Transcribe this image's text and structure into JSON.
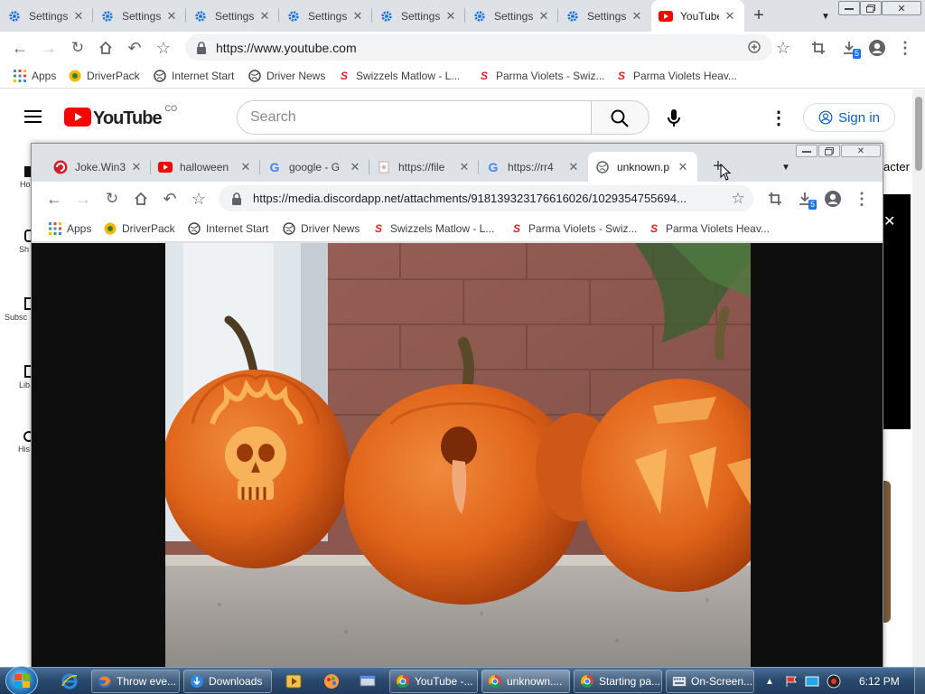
{
  "outer_window": {
    "tabs": [
      {
        "label": "Settings",
        "icon": "gear-icon"
      },
      {
        "label": "Settings",
        "icon": "gear-icon"
      },
      {
        "label": "Settings",
        "icon": "gear-icon"
      },
      {
        "label": "Settings",
        "icon": "gear-icon"
      },
      {
        "label": "Settings",
        "icon": "gear-icon"
      },
      {
        "label": "Settings",
        "icon": "gear-icon"
      },
      {
        "label": "Settings",
        "icon": "gear-icon"
      },
      {
        "label": "YouTube",
        "icon": "youtube-icon",
        "active": true
      }
    ],
    "url": "https://www.youtube.com",
    "download_badge": "5",
    "bookmarks": [
      "Apps",
      "DriverPack",
      "Internet Start",
      "Driver News",
      "Swizzels Matlow - L...",
      "Parma Violets - Swiz...",
      "Parma Violets Heav..."
    ]
  },
  "youtube": {
    "logo_text": "YouTube",
    "country_code": "CO",
    "search_placeholder": "Search",
    "sign_in": "Sign in",
    "sidebar": [
      "Ho",
      "Sh",
      "Subsc",
      "Lib",
      "His"
    ],
    "right_peek_text": "acter"
  },
  "inner_window": {
    "tabs": [
      {
        "label": "Joke.Win32",
        "icon": "antivirus-icon"
      },
      {
        "label": "halloween",
        "icon": "youtube-icon"
      },
      {
        "label": "google - G",
        "icon": "google-icon"
      },
      {
        "label": "https://file",
        "icon": "file-icon"
      },
      {
        "label": "https://rr4",
        "icon": "google-icon"
      },
      {
        "label": "unknown.p",
        "icon": "globe-icon",
        "active": true
      }
    ],
    "url": "https://media.discordapp.net/attachments/918139323176616026/1029354755694...",
    "download_badge": "5",
    "bookmarks": [
      "Apps",
      "DriverPack",
      "Internet Start",
      "Driver News",
      "Swizzels Matlow - L...",
      "Parma Violets - Swiz...",
      "Parma Violets Heav..."
    ]
  },
  "taskbar": {
    "items": [
      {
        "label": "Throw eve...",
        "icon": "firefox-icon"
      },
      {
        "label": "Downloads",
        "icon": "downloads-icon"
      },
      {
        "label": "YouTube -...",
        "icon": "chrome-icon"
      },
      {
        "label": "unknown....",
        "icon": "chrome-icon"
      },
      {
        "label": "Starting pa...",
        "icon": "chrome-icon"
      },
      {
        "label": "On-Screen...",
        "icon": "keyboard-icon"
      }
    ],
    "clock": "6:12 PM"
  },
  "colors": {
    "tab_strip": "#dee1e6",
    "youtube_red": "#ff0000",
    "pumpkin": "#e0641a",
    "taskbar": "#2a4a6e"
  }
}
